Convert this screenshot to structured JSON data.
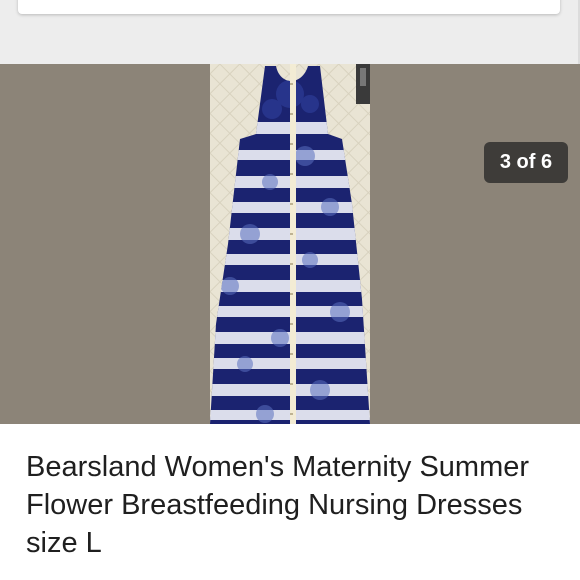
{
  "gallery": {
    "counter": "3 of 6",
    "photo_icon": "dress-photo"
  },
  "listing": {
    "title": "Bearsland Women's Maternity Summer Flower Breastfeeding Nursing Dresses size L"
  },
  "colors": {
    "photo_background": "#8c8478",
    "dress_navy": "#1b2370",
    "counter_background": "#2b2b2b"
  }
}
